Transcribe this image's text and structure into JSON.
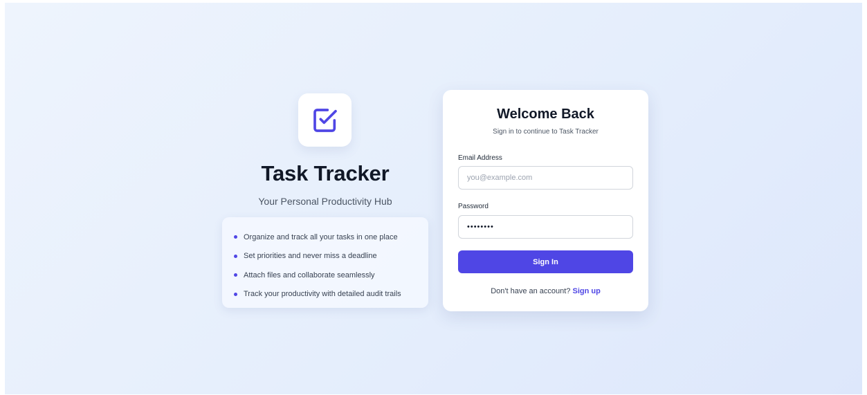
{
  "brand": {
    "logo_icon": "check-square-icon",
    "accent_color": "#4f46e5",
    "title": "Task Tracker",
    "subtitle": "Your Personal Productivity Hub",
    "features": [
      "Organize and track all your tasks in one place",
      "Set priorities and never miss a deadline",
      "Attach files and collaborate seamlessly",
      "Track your productivity with detailed audit trails"
    ]
  },
  "login": {
    "title": "Welcome Back",
    "subtitle": "Sign in to continue to Task Tracker",
    "email_label": "Email Address",
    "email_placeholder": "you@example.com",
    "email_value": "",
    "password_label": "Password",
    "password_value": "••••••••",
    "sign_in_label": "Sign In",
    "signup_prompt": "Don't have an account?",
    "signup_link": "Sign up"
  }
}
